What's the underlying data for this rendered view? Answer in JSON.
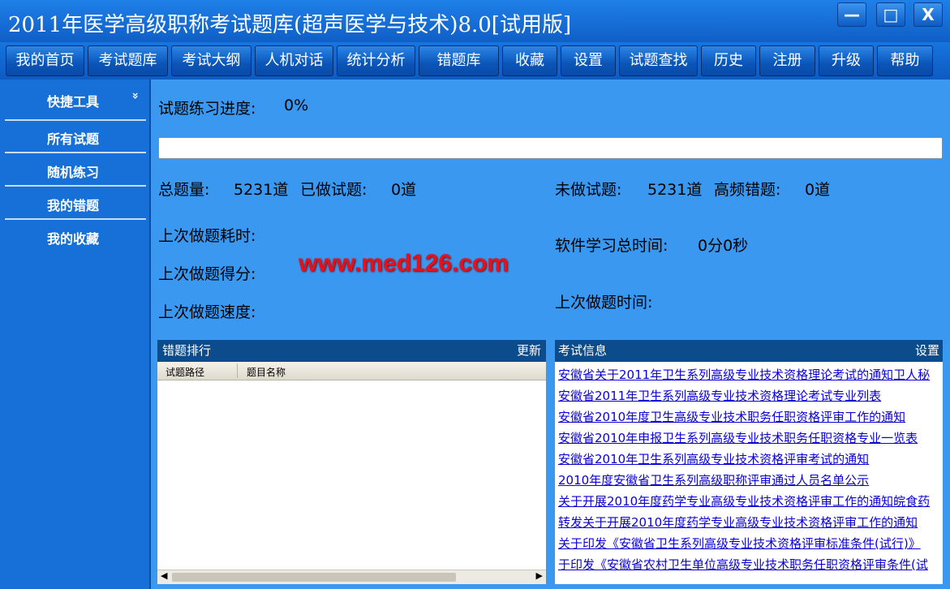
{
  "window": {
    "title": "2011年医学高级职称考试题库(超声医学与技术)8.0[试用版]",
    "minimize": "—",
    "maximize": "□",
    "close": "X"
  },
  "nav": [
    "我的首页",
    "考试题库",
    "考试大纲",
    "人机对话",
    "统计分析",
    "错题库",
    "收藏",
    "设置",
    "试题查找",
    "历史",
    "注册",
    "升级",
    "帮助"
  ],
  "sidebar": {
    "header": "快捷工具",
    "chevron": "»",
    "items": [
      "所有试题",
      "随机练习",
      "我的错题",
      "我的收藏"
    ]
  },
  "progress": {
    "label": "试题练习进度:",
    "value_text": "0%",
    "fraction": 0
  },
  "stats": {
    "total_label": "总题量:",
    "total_value": "5231道",
    "done_label": "已做试题:",
    "done_value": "0道",
    "undone_label": "未做试题:",
    "undone_value": "5231道",
    "freq_wrong_label": "高频错题:",
    "freq_wrong_value": "0道",
    "last_time_cost_label": "上次做题耗时:",
    "last_score_label": "上次做题得分:",
    "last_speed_label": "上次做题速度:",
    "total_study_label": "软件学习总时间:",
    "total_study_value": "0分0秒",
    "last_time_label": "上次做题时间:"
  },
  "watermark": "www.med126.com",
  "wrong_rank": {
    "title": "错题排行",
    "action": "更新",
    "columns": [
      "试题路径",
      "题目名称"
    ]
  },
  "exam_info": {
    "title": "考试信息",
    "action": "设置",
    "links": [
      "安徽省关于2011年卫生系列高级专业技术资格理论考试的通知卫人秘",
      "安徽省2011年卫生系列高级专业技术资格理论考试专业列表",
      "安徽省2010年度卫生高级专业技术职务任职资格评审工作的通知",
      "安徽省2010年申报卫生系列高级专业技术职务任职资格专业一览表",
      "安徽省2010年卫生系列高级专业技术资格评审考试的通知",
      "2010年度安徽省卫生系列高级职称评审通过人员名单公示",
      "关于开展2010年度药学专业高级专业技术资格评审工作的通知皖食药",
      "转发关于开展2010年度药学专业高级专业技术资格评审工作的通知",
      "关于印发《安徽省卫生系列高级专业技术资格评审标准条件(试行)》",
      "于印发《安徽省农村卫生单位高级专业技术职务任职资格评审条件(试"
    ]
  }
}
